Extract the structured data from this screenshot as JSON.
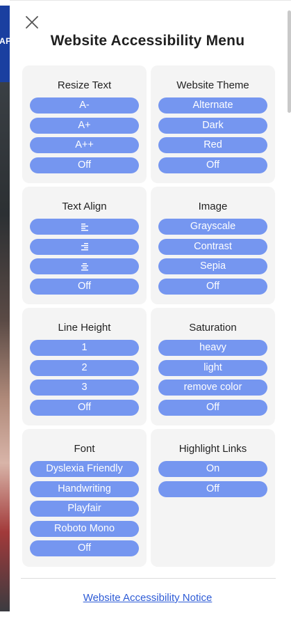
{
  "background": {
    "cut_text": "AP"
  },
  "panel": {
    "title": "Website Accessibility Menu",
    "notice_link": "Website Accessibility Notice"
  },
  "sections": {
    "resize_text": {
      "title": "Resize Text",
      "buttons": [
        "A-",
        "A+",
        "A++",
        "Off"
      ]
    },
    "website_theme": {
      "title": "Website Theme",
      "buttons": [
        "Alternate",
        "Dark",
        "Red",
        "Off"
      ]
    },
    "text_align": {
      "title": "Text Align",
      "buttons": [
        "align-left-icon",
        "align-right-icon",
        "align-center-icon",
        "Off"
      ]
    },
    "image": {
      "title": "Image",
      "buttons": [
        "Grayscale",
        "Contrast",
        "Sepia",
        "Off"
      ]
    },
    "line_height": {
      "title": "Line Height",
      "buttons": [
        "1",
        "2",
        "3",
        "Off"
      ]
    },
    "saturation": {
      "title": "Saturation",
      "buttons": [
        "heavy",
        "light",
        "remove color",
        "Off"
      ]
    },
    "font": {
      "title": "Font",
      "buttons": [
        "Dyslexia Friendly",
        "Handwriting",
        "Playfair",
        "Roboto Mono",
        "Off"
      ]
    },
    "highlight_links": {
      "title": "Highlight Links",
      "buttons": [
        "On",
        "Off"
      ]
    }
  },
  "colors": {
    "button": "#7596f0",
    "card": "#f4f4f4",
    "link": "#2d5bd6",
    "header_blue": "#1a3fa0"
  }
}
